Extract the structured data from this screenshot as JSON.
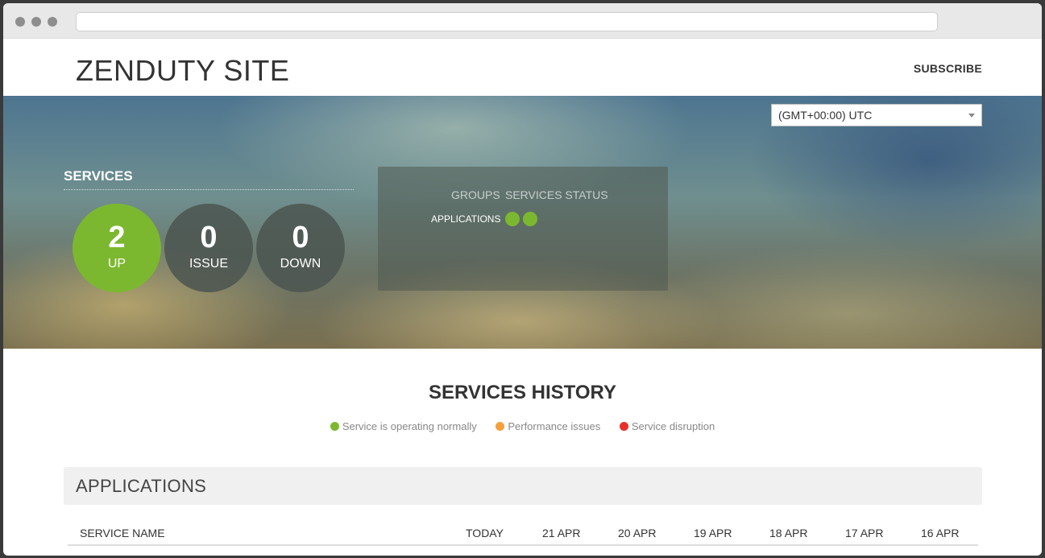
{
  "site": {
    "title": "ZENDUTY SITE",
    "subscribe_label": "SUBSCRIBE"
  },
  "timezone": {
    "selected": "(GMT+00:00) UTC"
  },
  "services": {
    "title": "SERVICES",
    "counts": [
      {
        "value": "2",
        "label": "UP",
        "color": "#7cb82f"
      },
      {
        "value": "0",
        "label": "ISSUE"
      },
      {
        "value": "0",
        "label": "DOWN"
      }
    ]
  },
  "status_box": {
    "col_groups": "GROUPS",
    "col_status": "SERVICES STATUS",
    "groups": [
      {
        "name": "APPLICATIONS",
        "dots": [
          "operational",
          "operational"
        ]
      }
    ]
  },
  "history": {
    "title": "SERVICES HISTORY",
    "legend": [
      {
        "label": "Service is operating normally",
        "color": "#7cb82f"
      },
      {
        "label": "Performance issues",
        "color": "#f5a03c"
      },
      {
        "label": "Service disruption",
        "color": "#e8302b"
      }
    ],
    "section_title": "APPLICATIONS",
    "columns": [
      "SERVICE NAME",
      "TODAY",
      "21 APR",
      "20 APR",
      "19 APR",
      "18 APR",
      "17 APR",
      "16 APR"
    ]
  }
}
